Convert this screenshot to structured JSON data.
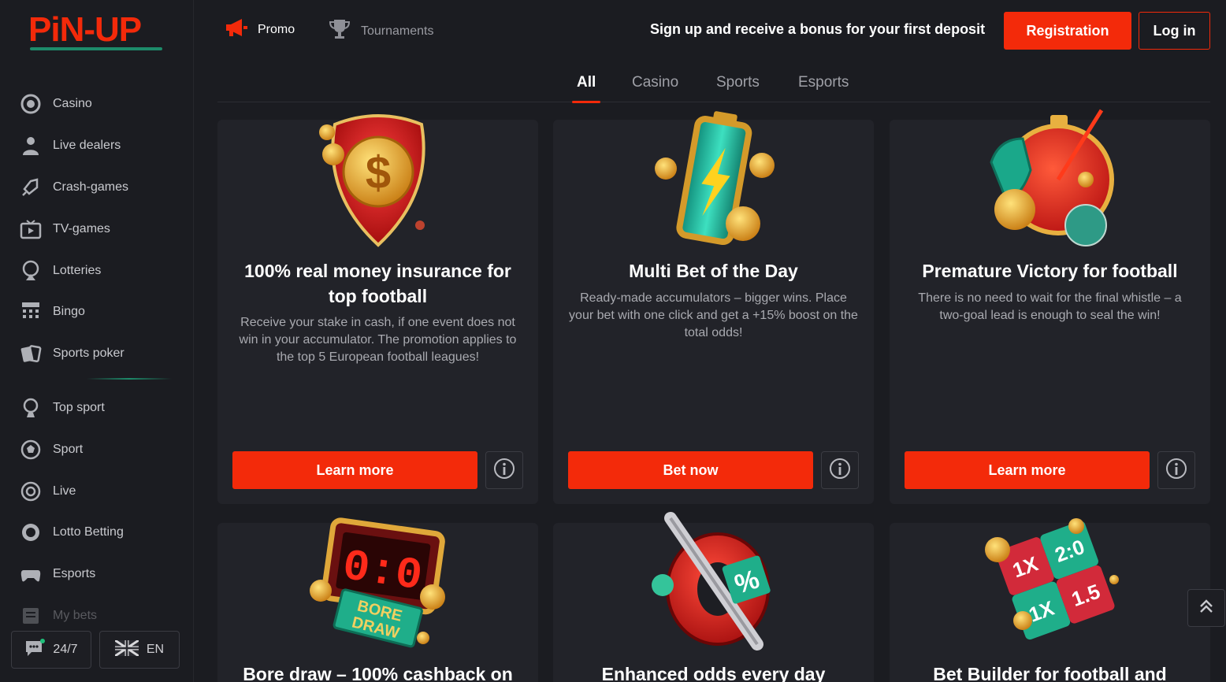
{
  "brand": {
    "logo_text": "PiN-UP",
    "accent": "#f32a0a",
    "green": "#1d8b6a"
  },
  "sidebar": {
    "items": [
      {
        "label": "Casino",
        "icon": "casino-chip-icon"
      },
      {
        "label": "Live dealers",
        "icon": "live-dealer-icon"
      },
      {
        "label": "Crash-games",
        "icon": "rocket-icon"
      },
      {
        "label": "TV-games",
        "icon": "tv-icon"
      },
      {
        "label": "Lotteries",
        "icon": "lottery-icon"
      },
      {
        "label": "Bingo",
        "icon": "bingo-icon"
      },
      {
        "label": "Sports poker",
        "icon": "cards-icon"
      }
    ],
    "sport_items": [
      {
        "label": "Top sport",
        "icon": "trophy-ball-icon"
      },
      {
        "label": "Sport",
        "icon": "soccer-ball-icon"
      },
      {
        "label": "Live",
        "icon": "live-target-icon"
      },
      {
        "label": "Lotto Betting",
        "icon": "lotto-ball-icon"
      },
      {
        "label": "Esports",
        "icon": "gamepad-icon"
      },
      {
        "label": "My bets",
        "icon": "receipt-icon"
      }
    ],
    "support_label": "24/7",
    "language_label": "EN"
  },
  "header": {
    "promo_label": "Promo",
    "tournaments_label": "Tournaments",
    "signup_text": "Sign up and receive a bonus for your first deposit",
    "registration_label": "Registration",
    "login_label": "Log in"
  },
  "tabs": [
    {
      "label": "All",
      "active": true
    },
    {
      "label": "Casino",
      "active": false
    },
    {
      "label": "Sports",
      "active": false
    },
    {
      "label": "Esports",
      "active": false
    }
  ],
  "cards": [
    {
      "title": "100% real money insurance for top football",
      "description": "Receive your stake in cash, if one event does not win in your accumulator. The promotion applies to the top 5 European football leagues!",
      "button": "Learn more",
      "art": "shield-dollar-coin-icon"
    },
    {
      "title": "Multi Bet of the Day",
      "description": "Ready-made accumulators – bigger wins. Place your bet with one click and get a +15% boost on the total odds!",
      "button": "Bet now",
      "art": "battery-lightning-icon"
    },
    {
      "title": "Premature Victory for football",
      "description": "There is no need to wait for the final whistle – a two-goal lead is enough to seal the win!",
      "button": "Learn more",
      "art": "stopwatch-foam-finger-icon"
    },
    {
      "title": "Bore draw – 100% cashback on",
      "art": "scoreboard-bore-draw-icon",
      "art_text": "BORE DRAW"
    },
    {
      "title": "Enhanced odds every day",
      "art": "percent-bat-icon"
    },
    {
      "title": "Bet Builder for football and",
      "art": "puzzle-cube-icon"
    }
  ]
}
